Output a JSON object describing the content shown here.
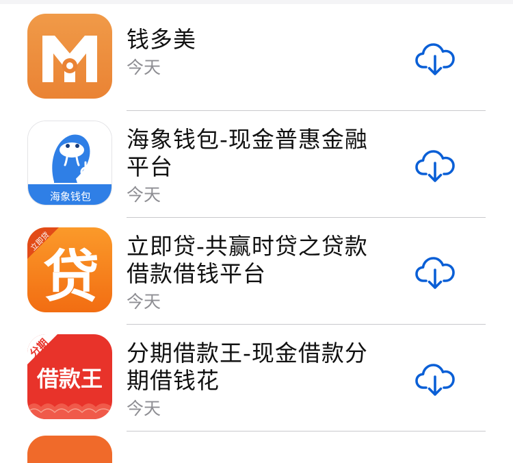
{
  "apps": [
    {
      "name": "钱多美",
      "date": "今天",
      "icon": "qianduomei-icon",
      "accent": "#ef8a3c"
    },
    {
      "name": "海象钱包-现金普惠金融平台",
      "date": "今天",
      "icon": "haixiang-wallet-icon",
      "icon_label": "海象钱包",
      "accent": "#2f7fe6"
    },
    {
      "name": "立即贷-共赢时贷之贷款借款借钱平台",
      "date": "今天",
      "icon": "lijidai-icon",
      "icon_glyph": "贷",
      "icon_badge": "立即贷",
      "accent": "#f7811f"
    },
    {
      "name": "分期借款王-现金借款分期借钱花",
      "date": "今天",
      "icon": "fenqi-jiekuanwang-icon",
      "icon_text": "借款王",
      "icon_badge": "分期",
      "accent": "#e8332a"
    }
  ],
  "download_icon": "cloud-download-icon",
  "download_color": "#0a5fd6"
}
